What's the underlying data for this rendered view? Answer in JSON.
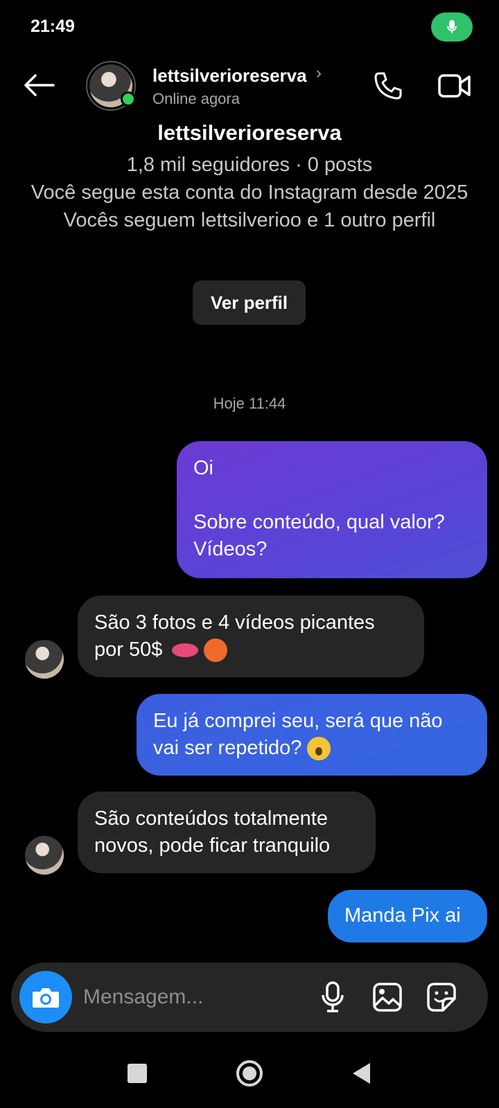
{
  "status_bar": {
    "time": "21:49"
  },
  "header": {
    "username": "lettsilverioreserva",
    "chevron": "›",
    "status": "Online agora"
  },
  "profile": {
    "name": "lettsilverioreserva",
    "stats": "1,8 mil seguidores · 0 posts",
    "follow_since": "Você segue esta conta do Instagram desde 2025",
    "mutual": "Vocês seguem lettsilverioo e 1 outro perfil",
    "view_profile_label": "Ver perfil"
  },
  "timestamp": "Hoje 11:44",
  "messages": [
    {
      "direction": "out",
      "line1": "Oi",
      "line2": "Sobre conteúdo, qual valor?",
      "line3": "Vídeos?"
    },
    {
      "direction": "in",
      "line1": "São 3 fotos e 4 vídeos picantes",
      "line2": "por 50$"
    },
    {
      "direction": "out",
      "line1": "Eu já comprei seu, será que não",
      "line2": "vai ser repetido?"
    },
    {
      "direction": "in",
      "line1": "São conteúdos totalmente",
      "line2": "novos, pode ficar tranquilo"
    },
    {
      "direction": "out",
      "line1": "Manda Pix ai"
    }
  ],
  "composer": {
    "placeholder": "Mensagem..."
  },
  "icons": {
    "back": "arrow-left-icon",
    "call": "phone-icon",
    "video": "video-camera-icon",
    "camera": "camera-icon",
    "mic": "microphone-icon",
    "gallery": "image-icon",
    "sticker": "sticker-icon"
  },
  "colors": {
    "outgoing_purple": "#6b3bd4",
    "outgoing_blue": "#3466e0",
    "outgoing_bright": "#1f7ae6",
    "incoming": "#262626",
    "camera_button": "#1c8ef5",
    "online": "#2fd158"
  }
}
